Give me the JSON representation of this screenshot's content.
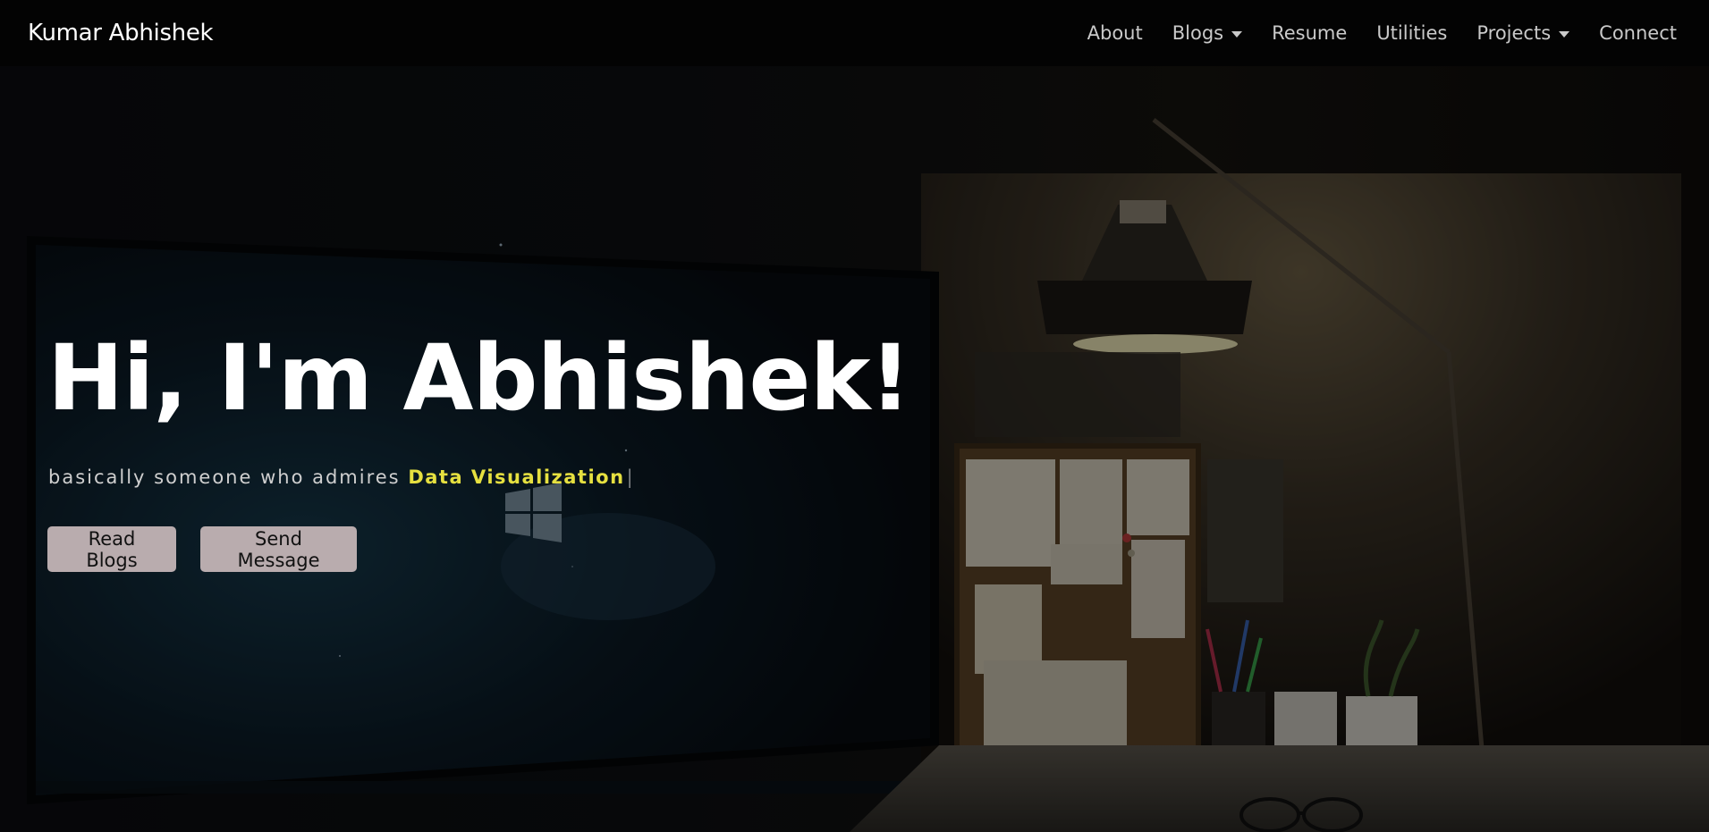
{
  "nav": {
    "brand": "Kumar Abhishek",
    "items": [
      {
        "label": "About",
        "dropdown": false
      },
      {
        "label": "Blogs",
        "dropdown": true
      },
      {
        "label": "Resume",
        "dropdown": false
      },
      {
        "label": "Utilities",
        "dropdown": false
      },
      {
        "label": "Projects",
        "dropdown": true
      },
      {
        "label": "Connect",
        "dropdown": false
      }
    ]
  },
  "hero": {
    "title": "Hi, I'm Abhishek!",
    "tagline_prefix": "basically someone who admires",
    "tagline_highlight": "Data Visualization",
    "tagline_cursor": "|",
    "buttons": {
      "read_blogs": "Read Blogs",
      "send_message": "Send Message"
    },
    "background_icons": [
      "monitor-icon",
      "windows-logo-icon",
      "desk-lamp-icon",
      "pinboard-icon",
      "pen-cup-icon",
      "glasses-icon"
    ]
  },
  "colors": {
    "navbar_bg": "#030303",
    "accent_highlight": "#e6e040",
    "button_bg": "#b9acae",
    "text_light": "#cfcfcf"
  }
}
